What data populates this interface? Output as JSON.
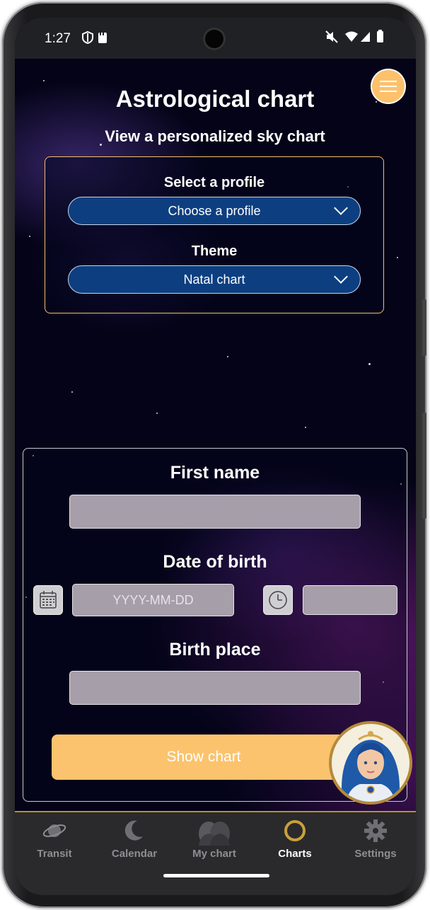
{
  "status_bar": {
    "time": "1:27"
  },
  "header": {
    "title": "Astrological chart",
    "subtitle": "View a personalized sky chart"
  },
  "profile_panel": {
    "profile_label": "Select a profile",
    "profile_value": "Choose a profile",
    "theme_label": "Theme",
    "theme_value": "Natal chart"
  },
  "form": {
    "first_name_label": "First name",
    "first_name_value": "",
    "dob_label": "Date of birth",
    "date_placeholder": "YYYY-MM-DD",
    "time_value": "",
    "birth_place_label": "Birth place",
    "birth_place_value": "",
    "submit_label": "Show chart"
  },
  "nav": {
    "items": [
      {
        "label": "Transit",
        "icon": "saturn-icon",
        "active": false
      },
      {
        "label": "Calendar",
        "icon": "moon-icon",
        "active": false
      },
      {
        "label": "My chart",
        "icon": "gemini-icon",
        "active": false
      },
      {
        "label": "Charts",
        "icon": "ring-icon",
        "active": true
      },
      {
        "label": "Settings",
        "icon": "gear-icon",
        "active": false
      }
    ]
  },
  "colors": {
    "accent": "#fdc16b",
    "select_bg": "#0d3f80",
    "nav_bg": "#2a2a2c",
    "nav_active": "#ffffff",
    "nav_inactive": "#8e8e92"
  }
}
